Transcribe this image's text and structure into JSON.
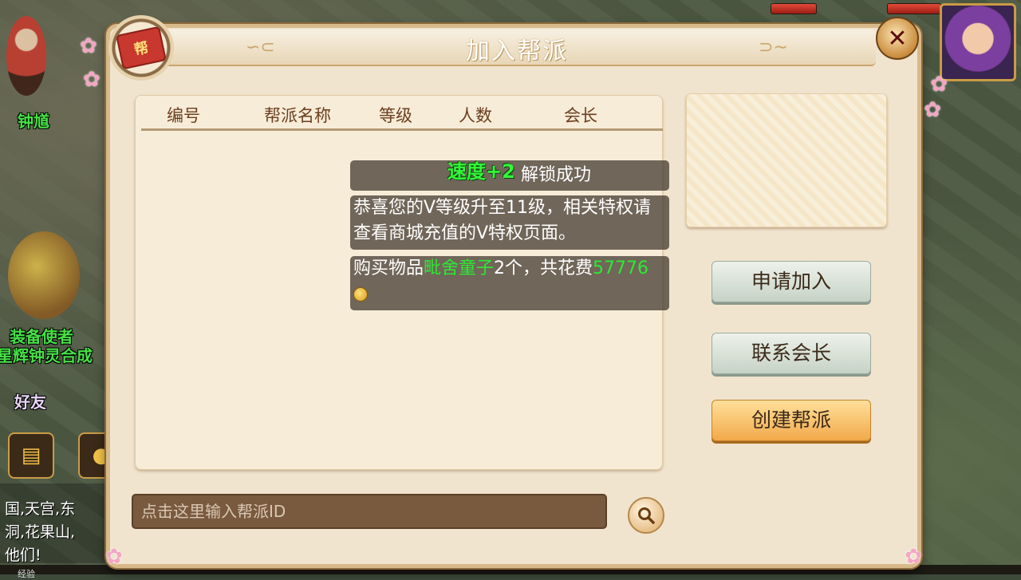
{
  "dialog": {
    "title": "加入帮派",
    "emblem_text": "帮",
    "close_symbol": "✕"
  },
  "table": {
    "columns": [
      "编号",
      "帮派名称",
      "等级",
      "人数",
      "会长"
    ]
  },
  "notifications": {
    "speed_popup": "速度+2",
    "first_tail": "解锁成功",
    "v_level_msg": "恭喜您的V等级升至11级，相关特权请查看商城充值的V特权页面。",
    "purchase": {
      "prefix": "购买物品",
      "item": "毗舍童子",
      "middle": "2个，共花费",
      "amount": "57776"
    }
  },
  "buttons": {
    "apply": "申请加入",
    "contact": "联系会长",
    "create": "创建帮派"
  },
  "search": {
    "placeholder": "点击这里输入帮派ID"
  },
  "background": {
    "npc_top": "钟馗",
    "npc_mid_1": "装备使者",
    "npc_mid_2": "星辉钟灵合成",
    "friends": "好友",
    "chat_lines": [
      "国,天宫,东",
      "洞,花果山,",
      "他们!"
    ],
    "exp_label": "经验"
  },
  "colors": {
    "highlight_green": "#2ee835",
    "button_primary": "#f2a94a",
    "dialog_bg": "#f1e4cf"
  }
}
